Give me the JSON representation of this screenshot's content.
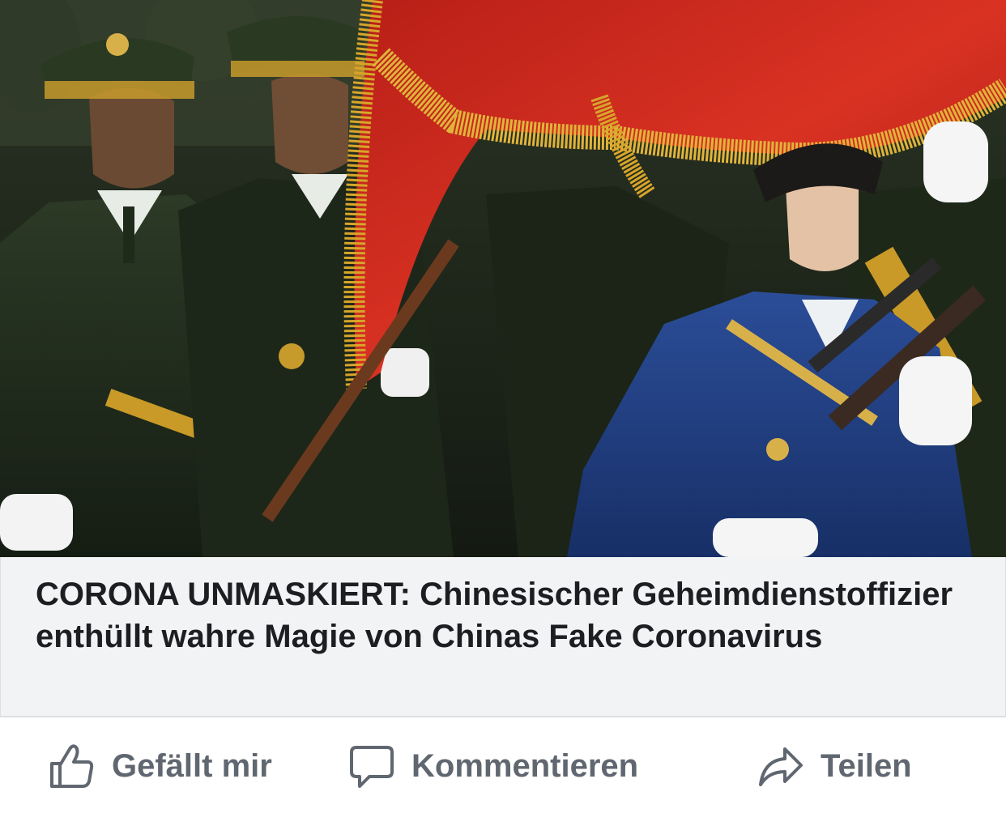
{
  "post": {
    "headline": "CORONA UNMASKIERT: Chinesischer Geheimdienstoffizier enthüllt wahre Magie von Chinas Fake Coronavirus"
  },
  "photo": {
    "subject": "parade-honor-guard-with-red-flag"
  },
  "actions": {
    "like_label": "Gefällt mir",
    "comment_label": "Kommentieren",
    "share_label": "Teilen",
    "like_icon": "thumbs-up-icon",
    "comment_icon": "speech-bubble-icon",
    "share_icon": "share-arrow-icon"
  },
  "colors": {
    "action_text": "#606770",
    "headline_text": "#1c1e21",
    "link_box_bg": "#f2f3f5",
    "flag_red": "#c8281e",
    "fringe_gold": "#d8a52a",
    "uniform_green": "#1f2a1c",
    "uniform_blue": "#1f3f86"
  }
}
